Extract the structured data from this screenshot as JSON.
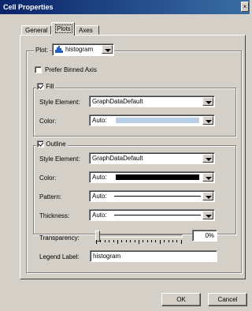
{
  "window": {
    "title": "Cell Properties",
    "close_glyph": "×"
  },
  "tabs": [
    {
      "label": "General"
    },
    {
      "label": "Plots"
    },
    {
      "label": "Axes"
    }
  ],
  "plot": {
    "label": "Plot:",
    "selected": "histogram",
    "icon": "histogram-icon"
  },
  "prefer_binned_axis": {
    "label": "Prefer Binned Axis",
    "checked": false
  },
  "fill": {
    "label": "Fill",
    "checked": true,
    "style_element_label": "Style Element:",
    "style_element_value": "GraphDataDefault",
    "color_label": "Color:",
    "color_value": "Auto:",
    "color_swatch": "#b9cfe6"
  },
  "outline": {
    "label": "Outline",
    "checked": true,
    "style_element_label": "Style Element:",
    "style_element_value": "GraphDataDefault",
    "color_label": "Color:",
    "color_value": "Auto:",
    "color_swatch": "#000000",
    "pattern_label": "Pattern:",
    "pattern_value": "Auto:",
    "thickness_label": "Thickness:",
    "thickness_value": "Auto:"
  },
  "transparency": {
    "label": "Transparency:",
    "value": "0%",
    "fraction": 0
  },
  "legend": {
    "label": "Legend Label:",
    "value": "histogram"
  },
  "buttons": {
    "ok": "OK",
    "cancel": "Cancel"
  }
}
